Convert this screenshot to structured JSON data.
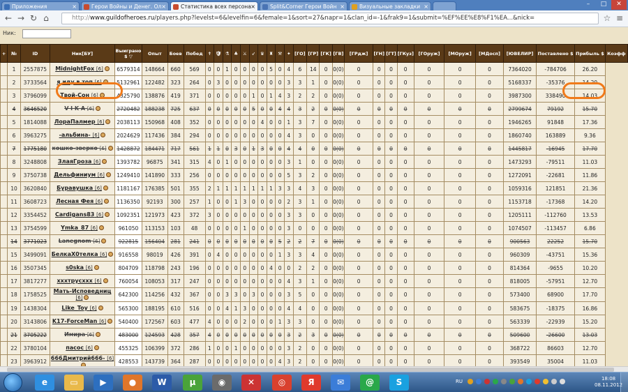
{
  "tabs": [
    {
      "label": "Приложения",
      "color": "#3b6fb6"
    },
    {
      "label": "Герои Войны и Денег. Ол",
      "color": "#c94b2d"
    },
    {
      "label": "Статистика всех персона",
      "color": "#c94b2d"
    },
    {
      "label": "Split&Corner Герои Войн",
      "color": "#4a74b4"
    },
    {
      "label": "Визуальные закладки",
      "color": "#e0a020"
    }
  ],
  "window": {
    "minimize": "–",
    "maximize": "□",
    "close": "✕"
  },
  "address": {
    "scheme": "http://",
    "host": "www.guildofheroes.ru",
    "path": "/players.php?levelst=6&levelfin=6&female=1&sort=27&napr=1&clan_id=-1&frak9=1&submit=%EF%EE%E8%F1%EA...&nick="
  },
  "search": {
    "label": "Ник:",
    "value": ""
  },
  "table": {
    "headers": [
      "+",
      "№",
      "ID",
      "Ник[БУ]",
      "Выиграно $ ▽",
      "Опыт",
      "Боев",
      "Побед",
      "✝",
      "🛡",
      "⚗",
      "♣",
      "⚔",
      "➶",
      "♛",
      "♜",
      "⚒",
      "✦",
      "[ГО]",
      "[ГР]",
      "[ГК]",
      "[ГВ]",
      "[ГРдж]",
      "[ГН]",
      "[ГТ]",
      "[ГКуз]",
      "[ГОруж]",
      "[МОруж]",
      "[МДосп]",
      "[ЮВЕЛИР]",
      "Поставлено $",
      "Прибыль $",
      "Коэфф"
    ],
    "rows": [
      {
        "n": "1",
        "id": "2557875",
        "nick": "MidnightFox",
        "lvl": "[6]",
        "won": "6579314",
        "exp": "148664",
        "fights": "660",
        "wins": "569",
        "g": [
          "0",
          "0",
          "1",
          "0",
          "0",
          "0",
          "0",
          "5",
          "0"
        ],
        "go": "4",
        "gr": "6",
        "gk": "14",
        "gv": "0",
        "grdj": "0(0)",
        "gn": "0",
        "gt": "0",
        "gkuz": "0",
        "goruj": "0",
        "moruj": "0",
        "mdosp": "0",
        "juv": "0",
        "placed": "7364020",
        "profit": "-784706",
        "coef": "26.20",
        "struck": false
      },
      {
        "n": "2",
        "id": "3733564",
        "nick": "я иду в топ",
        "lvl": "[6]",
        "won": "5132961",
        "exp": "122482",
        "fights": "323",
        "wins": "264",
        "g": [
          "0",
          "3",
          "0",
          "0",
          "0",
          "0",
          "0",
          "0",
          "0"
        ],
        "go": "3",
        "gr": "3",
        "gk": "1",
        "gv": "0",
        "grdj": "0(0)",
        "gn": "0",
        "gt": "0",
        "gkuz": "0",
        "goruj": "0",
        "moruj": "0",
        "mdosp": "0",
        "juv": "0",
        "placed": "5168337",
        "profit": "-35376",
        "coef": "14.20",
        "struck": false
      },
      {
        "n": "3",
        "id": "3796099",
        "nick": "Твой-Сон",
        "lvl": "[6]",
        "won": "4325790",
        "exp": "138876",
        "fights": "419",
        "wins": "371",
        "g": [
          "0",
          "0",
          "0",
          "0",
          "0",
          "1",
          "0",
          "1",
          "4"
        ],
        "go": "3",
        "gr": "2",
        "gk": "2",
        "gv": "0",
        "grdj": "0(0)",
        "gn": "0",
        "gt": "0",
        "gkuz": "0",
        "goruj": "0",
        "moruj": "0",
        "mdosp": "0",
        "juv": "0",
        "placed": "3987300",
        "profit": "338490",
        "coef": "14.03",
        "struck": false
      },
      {
        "n": "4",
        "id": "3646520",
        "nick": "V I K A",
        "lvl": "[6]",
        "won": "2720482",
        "exp": "188238",
        "fights": "725",
        "wins": "637",
        "g": [
          "0",
          "0",
          "0",
          "0",
          "0",
          "5",
          "0",
          "0",
          "4"
        ],
        "go": "4",
        "gr": "3",
        "gk": "2",
        "gv": "0",
        "grdj": "0(0)",
        "gn": "0",
        "gt": "0",
        "gkuz": "0",
        "goruj": "0",
        "moruj": "0",
        "mdosp": "0",
        "juv": "0",
        "placed": "2799674",
        "profit": "79192",
        "coef": "15.70",
        "struck": true
      },
      {
        "n": "5",
        "id": "1814088",
        "nick": "ЛораПалмер",
        "lvl": "[6]",
        "won": "2038113",
        "exp": "150968",
        "fights": "408",
        "wins": "352",
        "g": [
          "0",
          "0",
          "0",
          "0",
          "0",
          "0",
          "4",
          "0",
          "0"
        ],
        "go": "1",
        "gr": "3",
        "gk": "7",
        "gv": "0",
        "grdj": "0(0)",
        "gn": "0",
        "gt": "0",
        "gkuz": "0",
        "goruj": "0",
        "moruj": "0",
        "mdosp": "0",
        "juv": "0",
        "placed": "1946265",
        "profit": "91848",
        "coef": "17.36",
        "struck": false
      },
      {
        "n": "6",
        "id": "3963275",
        "nick": "-альбина-",
        "lvl": "[6]",
        "won": "2024629",
        "exp": "117436",
        "fights": "384",
        "wins": "294",
        "g": [
          "0",
          "0",
          "0",
          "0",
          "0",
          "0",
          "0",
          "0",
          "0"
        ],
        "go": "4",
        "gr": "3",
        "gk": "0",
        "gv": "0",
        "grdj": "0(0)",
        "gn": "0",
        "gt": "0",
        "gkuz": "0",
        "goruj": "0",
        "moruj": "0",
        "mdosp": "0",
        "juv": "0",
        "placed": "1860740",
        "profit": "163889",
        "coef": "9.36",
        "struck": false
      },
      {
        "n": "7",
        "id": "1775180",
        "nick": "кошко-зверко",
        "lvl": "[6]",
        "won": "1428872",
        "exp": "184471",
        "fights": "717",
        "wins": "561",
        "g": [
          "1",
          "1",
          "0",
          "3",
          "0",
          "1",
          "3",
          "0",
          "0"
        ],
        "go": "4",
        "gr": "4",
        "gk": "0",
        "gv": "0",
        "grdj": "0(0)",
        "gn": "0",
        "gt": "0",
        "gkuz": "0",
        "goruj": "0",
        "moruj": "0",
        "mdosp": "0",
        "juv": "0",
        "placed": "1445817",
        "profit": "-16945",
        "coef": "17.70",
        "struck": true
      },
      {
        "n": "8",
        "id": "3248808",
        "nick": "ЗлаяГроза",
        "lvl": "[6]",
        "won": "1393782",
        "exp": "96875",
        "fights": "341",
        "wins": "315",
        "g": [
          "4",
          "0",
          "1",
          "0",
          "0",
          "0",
          "0",
          "0",
          "0"
        ],
        "go": "3",
        "gr": "1",
        "gk": "0",
        "gv": "0",
        "grdj": "0(0)",
        "gn": "0",
        "gt": "0",
        "gkuz": "0",
        "goruj": "0",
        "moruj": "0",
        "mdosp": "0",
        "juv": "0",
        "placed": "1473293",
        "profit": "-79511",
        "coef": "11.03",
        "struck": false
      },
      {
        "n": "9",
        "id": "3750738",
        "nick": "Дельфиниум",
        "lvl": "[6]",
        "won": "1249410",
        "exp": "141890",
        "fights": "333",
        "wins": "256",
        "g": [
          "0",
          "0",
          "0",
          "0",
          "0",
          "0",
          "0",
          "0",
          "0"
        ],
        "go": "5",
        "gr": "3",
        "gk": "2",
        "gv": "0",
        "grdj": "0(0)",
        "gn": "0",
        "gt": "0",
        "gkuz": "0",
        "goruj": "0",
        "moruj": "0",
        "mdosp": "0",
        "juv": "0",
        "placed": "1272091",
        "profit": "-22681",
        "coef": "11.86",
        "struck": false
      },
      {
        "n": "10",
        "id": "3620840",
        "nick": "Буравушка",
        "lvl": "[6]",
        "won": "1181167",
        "exp": "176385",
        "fights": "501",
        "wins": "355",
        "g": [
          "2",
          "1",
          "1",
          "1",
          "1",
          "1",
          "1",
          "1",
          "3"
        ],
        "go": "3",
        "gr": "4",
        "gk": "3",
        "gv": "0",
        "grdj": "0(0)",
        "gn": "0",
        "gt": "0",
        "gkuz": "0",
        "goruj": "0",
        "moruj": "0",
        "mdosp": "0",
        "juv": "0",
        "placed": "1059316",
        "profit": "121851",
        "coef": "21.36",
        "struck": false
      },
      {
        "n": "11",
        "id": "3608723",
        "nick": "Лесная Фея",
        "lvl": "[6]",
        "won": "1136350",
        "exp": "92193",
        "fights": "300",
        "wins": "257",
        "g": [
          "1",
          "0",
          "0",
          "1",
          "3",
          "0",
          "0",
          "0",
          "0"
        ],
        "go": "2",
        "gr": "3",
        "gk": "1",
        "gv": "0",
        "grdj": "0(0)",
        "gn": "0",
        "gt": "0",
        "gkuz": "0",
        "goruj": "0",
        "moruj": "0",
        "mdosp": "0",
        "juv": "0",
        "placed": "1153718",
        "profit": "-17368",
        "coef": "14.20",
        "struck": false
      },
      {
        "n": "12",
        "id": "3354452",
        "nick": "Cardigans83",
        "lvl": "[6]",
        "won": "1092351",
        "exp": "121973",
        "fights": "423",
        "wins": "372",
        "g": [
          "3",
          "0",
          "0",
          "0",
          "0",
          "0",
          "0",
          "0",
          "0"
        ],
        "go": "3",
        "gr": "3",
        "gk": "0",
        "gv": "0",
        "grdj": "0(0)",
        "gn": "0",
        "gt": "0",
        "gkuz": "0",
        "goruj": "0",
        "moruj": "0",
        "mdosp": "0",
        "juv": "0",
        "placed": "1205111",
        "profit": "-112760",
        "coef": "13.53",
        "struck": false
      },
      {
        "n": "13",
        "id": "3754599",
        "nick": "Ymka_87",
        "lvl": "[6]",
        "won": "961050",
        "exp": "113153",
        "fights": "103",
        "wins": "48",
        "g": [
          "0",
          "0",
          "0",
          "0",
          "1",
          "0",
          "0",
          "0",
          "0"
        ],
        "go": "3",
        "gr": "0",
        "gk": "0",
        "gv": "0",
        "grdj": "0(0)",
        "gn": "0",
        "gt": "0",
        "gkuz": "0",
        "goruj": "0",
        "moruj": "0",
        "mdosp": "0",
        "juv": "0",
        "placed": "1074507",
        "profit": "-113457",
        "coef": "6.86",
        "struck": false
      },
      {
        "n": "14",
        "id": "3771023",
        "nick": "Lanegnom",
        "lvl": "[6]",
        "won": "922815",
        "exp": "156404",
        "fights": "281",
        "wins": "241",
        "g": [
          "0",
          "0",
          "0",
          "0",
          "0",
          "0",
          "0",
          "0",
          "5"
        ],
        "go": "2",
        "gr": "2",
        "gk": "7",
        "gv": "0",
        "grdj": "0(0)",
        "gn": "0",
        "gt": "0",
        "gkuz": "0",
        "goruj": "0",
        "moruj": "0",
        "mdosp": "0",
        "juv": "0",
        "placed": "900563",
        "profit": "22252",
        "coef": "15.70",
        "struck": true
      },
      {
        "n": "15",
        "id": "3499091",
        "nick": "БелкаХ0телка",
        "lvl": "[6]",
        "won": "916558",
        "exp": "98019",
        "fights": "426",
        "wins": "391",
        "g": [
          "0",
          "4",
          "0",
          "0",
          "0",
          "0",
          "0",
          "0",
          "1"
        ],
        "go": "3",
        "gr": "3",
        "gk": "4",
        "gv": "0",
        "grdj": "0(0)",
        "gn": "0",
        "gt": "0",
        "gkuz": "0",
        "goruj": "0",
        "moruj": "0",
        "mdosp": "0",
        "juv": "0",
        "placed": "960309",
        "profit": "-43751",
        "coef": "15.36",
        "struck": false
      },
      {
        "n": "16",
        "id": "3507345",
        "nick": "s0ska",
        "lvl": "[6]",
        "won": "804709",
        "exp": "118798",
        "fights": "243",
        "wins": "196",
        "g": [
          "0",
          "0",
          "0",
          "0",
          "0",
          "0",
          "0",
          "4",
          "0"
        ],
        "go": "0",
        "gr": "2",
        "gk": "2",
        "gv": "0",
        "grdj": "0(0)",
        "gn": "0",
        "gt": "0",
        "gkuz": "0",
        "goruj": "0",
        "moruj": "0",
        "mdosp": "0",
        "juv": "0",
        "placed": "814364",
        "profit": "-9655",
        "coef": "10.20",
        "struck": false
      },
      {
        "n": "17",
        "id": "3817277",
        "nick": "хххтрусххх",
        "lvl": "[6]",
        "won": "760054",
        "exp": "108053",
        "fights": "317",
        "wins": "247",
        "g": [
          "0",
          "0",
          "0",
          "0",
          "0",
          "0",
          "0",
          "0",
          "0"
        ],
        "go": "4",
        "gr": "3",
        "gk": "1",
        "gv": "0",
        "grdj": "0(0)",
        "gn": "0",
        "gt": "0",
        "gkuz": "0",
        "goruj": "0",
        "moruj": "0",
        "mdosp": "0",
        "juv": "0",
        "placed": "818005",
        "profit": "-57951",
        "coef": "12.70",
        "struck": false
      },
      {
        "n": "18",
        "id": "1758525",
        "nick": "Мать-Исповедниц",
        "lvl": "[6]",
        "won": "642300",
        "exp": "114256",
        "fights": "432",
        "wins": "367",
        "g": [
          "0",
          "0",
          "3",
          "3",
          "0",
          "3",
          "0",
          "0",
          "0"
        ],
        "go": "3",
        "gr": "5",
        "gk": "0",
        "gv": "0",
        "grdj": "0(0)",
        "gn": "0",
        "gt": "0",
        "gkuz": "0",
        "goruj": "0",
        "moruj": "0",
        "mdosp": "0",
        "juv": "0",
        "placed": "573400",
        "profit": "68900",
        "coef": "17.70",
        "struck": false
      },
      {
        "n": "19",
        "id": "1438304",
        "nick": "Like_Toy",
        "lvl": "[6]",
        "won": "565300",
        "exp": "188195",
        "fights": "610",
        "wins": "516",
        "g": [
          "0",
          "0",
          "4",
          "1",
          "3",
          "0",
          "0",
          "0",
          "0"
        ],
        "go": "4",
        "gr": "4",
        "gk": "0",
        "gv": "0",
        "grdj": "0(0)",
        "gn": "0",
        "gt": "0",
        "gkuz": "0",
        "goruj": "0",
        "moruj": "0",
        "mdosp": "0",
        "juv": "0",
        "placed": "583675",
        "profit": "-18375",
        "coef": "16.86",
        "struck": false
      },
      {
        "n": "20",
        "id": "3143806",
        "nick": "K17-ForceMan",
        "lvl": "[6]",
        "won": "540400",
        "exp": "172567",
        "fights": "603",
        "wins": "477",
        "g": [
          "4",
          "0",
          "0",
          "0",
          "2",
          "0",
          "0",
          "0",
          "1"
        ],
        "go": "3",
        "gr": "3",
        "gk": "0",
        "gv": "0",
        "grdj": "0(0)",
        "gn": "0",
        "gt": "0",
        "gkuz": "0",
        "goruj": "0",
        "moruj": "0",
        "mdosp": "0",
        "juv": "0",
        "placed": "563339",
        "profit": "-22939",
        "coef": "15.20",
        "struck": false
      },
      {
        "n": "21",
        "id": "3705222",
        "nick": "Имира",
        "lvl": "[6]",
        "won": "483000",
        "exp": "124593",
        "fights": "428",
        "wins": "357",
        "g": [
          "4",
          "0",
          "0",
          "0",
          "0",
          "0",
          "0",
          "0",
          "0"
        ],
        "go": "3",
        "gr": "2",
        "gk": "3",
        "gv": "0",
        "grdj": "0(0)",
        "gn": "0",
        "gt": "0",
        "gkuz": "0",
        "goruj": "0",
        "moruj": "0",
        "mdosp": "0",
        "juv": "0",
        "placed": "509600",
        "profit": "-26600",
        "coef": "13.03",
        "struck": true
      },
      {
        "n": "22",
        "id": "3780104",
        "nick": "пасос",
        "lvl": "[6]",
        "won": "455325",
        "exp": "106399",
        "fights": "372",
        "wins": "286",
        "g": [
          "1",
          "0",
          "0",
          "1",
          "0",
          "0",
          "0",
          "0",
          "0"
        ],
        "go": "3",
        "gr": "2",
        "gk": "0",
        "gv": "0",
        "grdj": "0(0)",
        "gn": "0",
        "gt": "0",
        "gkuz": "0",
        "goruj": "0",
        "moruj": "0",
        "mdosp": "0",
        "juv": "0",
        "placed": "368722",
        "profit": "86603",
        "coef": "12.70",
        "struck": false
      },
      {
        "n": "23",
        "id": "3963912",
        "nick": "666Дмитрий666-",
        "lvl": "[6]",
        "won": "428553",
        "exp": "143739",
        "fights": "364",
        "wins": "287",
        "g": [
          "0",
          "0",
          "0",
          "0",
          "0",
          "0",
          "0",
          "0",
          "4"
        ],
        "go": "3",
        "gr": "2",
        "gk": "0",
        "gv": "0",
        "grdj": "0(0)",
        "gn": "0",
        "gt": "0",
        "gkuz": "0",
        "goruj": "0",
        "moruj": "0",
        "mdosp": "0",
        "juv": "0",
        "placed": "393549",
        "profit": "35004",
        "coef": "11.03",
        "struck": false
      }
    ]
  },
  "taskbar": {
    "apps": [
      {
        "name": "internet-explorer",
        "glyph": "e",
        "color": "#2f8fe0"
      },
      {
        "name": "file-explorer",
        "glyph": "▭",
        "color": "#e9b94a"
      },
      {
        "name": "media-player",
        "glyph": "▶",
        "color": "#2d6fbf"
      },
      {
        "name": "firefox",
        "glyph": "●",
        "color": "#e0762a"
      },
      {
        "name": "word",
        "glyph": "W",
        "color": "#2c5ba8"
      },
      {
        "name": "utorrent",
        "glyph": "μ",
        "color": "#4aa33a"
      },
      {
        "name": "game-app",
        "glyph": "◉",
        "color": "#6b6b6b"
      },
      {
        "name": "paint-app",
        "glyph": "✕",
        "color": "#c33"
      },
      {
        "name": "chrome",
        "glyph": "◎",
        "color": "#d9412e"
      },
      {
        "name": "yandex",
        "glyph": "Я",
        "color": "#e03a2c"
      },
      {
        "name": "mail",
        "glyph": "✉",
        "color": "#3b7dd8"
      },
      {
        "name": "agent",
        "glyph": "@",
        "color": "#2aa84a"
      },
      {
        "name": "skype",
        "glyph": "S",
        "color": "#1aa1e0"
      }
    ],
    "lang": "RU",
    "time": "18:08",
    "date": "08.11.2012"
  }
}
